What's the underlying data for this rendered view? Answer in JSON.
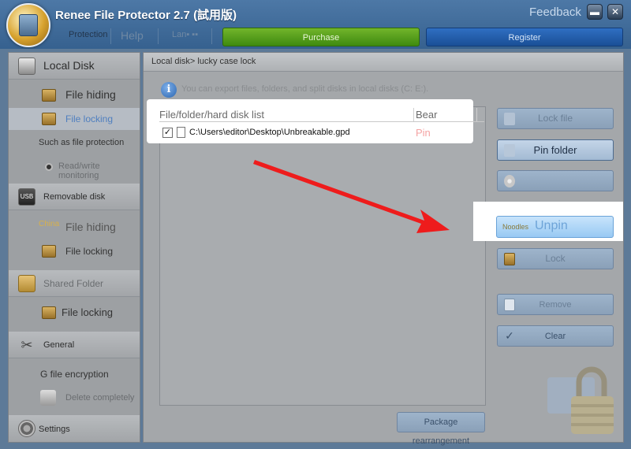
{
  "app": {
    "title": "Renee File Protector 2.7 (試用版)",
    "feedback": "Feedback"
  },
  "menu": {
    "protection": "Protection",
    "help": "Help",
    "language": "Lan▪ ▪▪",
    "purchase": "Purchase",
    "register": "Register"
  },
  "sidebar": {
    "local_disk": {
      "header": "Local Disk",
      "items": [
        "File hiding",
        "File locking",
        "Such as file protection",
        "Read/write monitoring"
      ]
    },
    "removable_disk": {
      "header": "Removable disk",
      "items": [
        "File hiding",
        "File locking"
      ],
      "icon_text": "China"
    },
    "shared_folder": {
      "header": "Shared Folder",
      "items": [
        "File locking"
      ]
    },
    "general": {
      "header": "General",
      "items": [
        "G file encryption",
        "Delete completely"
      ]
    },
    "settings": "Settings"
  },
  "main": {
    "breadcrumb": "Local disk> lucky case lock",
    "info_text": "You can export files, folders, and split disks in local disks (C: E:).",
    "list": {
      "col_path": "File/folder/hard disk list",
      "col_status": "Bear",
      "rows": [
        {
          "checked": true,
          "path": "C:\\Users\\editor\\Desktop\\Unbreakable.gpd",
          "status": "Pin"
        }
      ]
    },
    "buttons": {
      "lock_file": "Lock file",
      "pin_folder": "Pin folder",
      "unpin": "Unpin",
      "unpin_icon_text": "Noodles",
      "lock": "Lock",
      "remove": "Remove",
      "clear": "Clear",
      "package": "Package rearrangement"
    }
  },
  "colors": {
    "purchase": "#5aa11e",
    "register": "#2363b0",
    "arrow": "#ee1c1c",
    "pin_text": "#f4a3a3"
  }
}
